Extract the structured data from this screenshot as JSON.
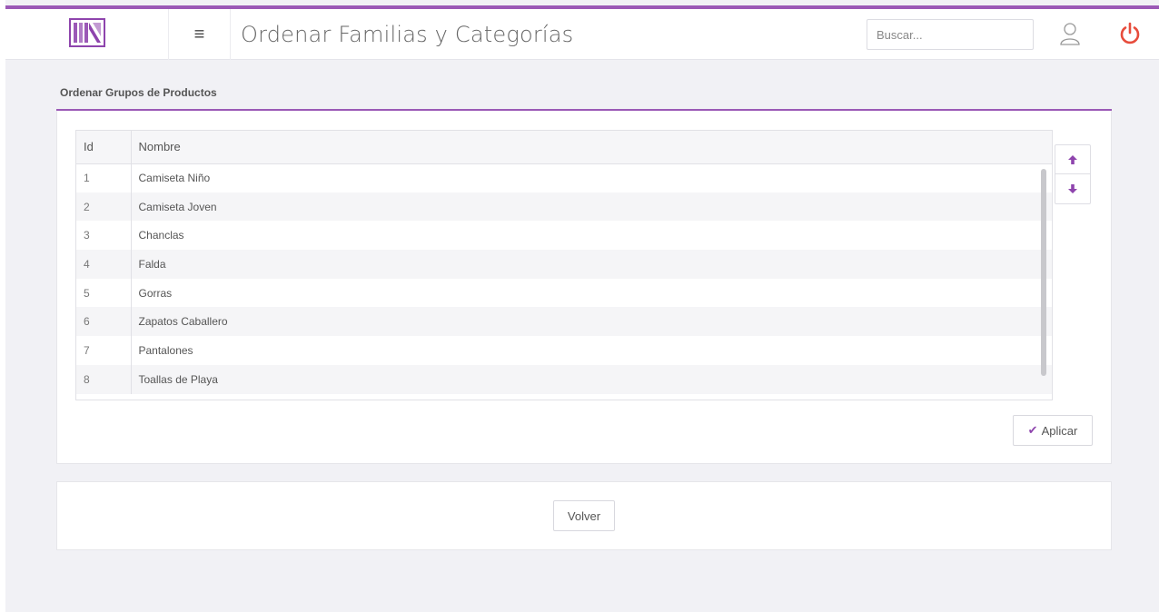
{
  "header": {
    "menu_icon": "hamburger-icon",
    "title": "Ordenar Familias y Categorías",
    "search_placeholder": "Buscar...",
    "user_icon": "user-icon",
    "power_icon": "power-icon",
    "accent_color": "#9b59b6",
    "power_color": "#e74c3c"
  },
  "panel": {
    "heading": "Ordenar Grupos de Productos",
    "table": {
      "columns": [
        "Id",
        "Nombre"
      ],
      "rows": [
        {
          "id": "1",
          "name": "Camiseta Niño"
        },
        {
          "id": "2",
          "name": "Camiseta Joven"
        },
        {
          "id": "3",
          "name": "Chanclas"
        },
        {
          "id": "4",
          "name": "Falda"
        },
        {
          "id": "5",
          "name": "Gorras"
        },
        {
          "id": "6",
          "name": "Zapatos Caballero"
        },
        {
          "id": "7",
          "name": "Pantalones"
        },
        {
          "id": "8",
          "name": "Toallas de Playa"
        }
      ]
    },
    "move_up_icon": "arrow-up-icon",
    "move_down_icon": "arrow-down-icon",
    "apply_label": "Aplicar"
  },
  "footer": {
    "back_label": "Volver"
  }
}
